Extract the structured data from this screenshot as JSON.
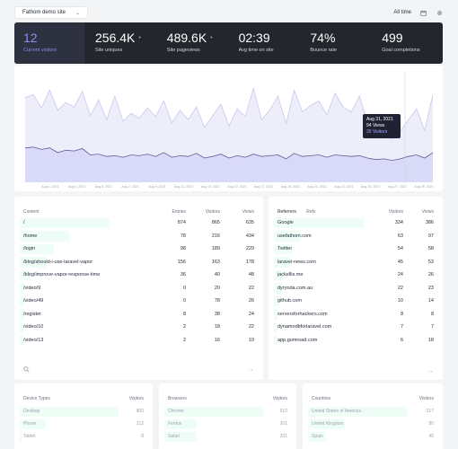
{
  "topbar": {
    "site": "Fathom demo site",
    "range": "All time",
    "calendar_icon": "calendar-icon",
    "settings_icon": "gear-icon"
  },
  "stats": [
    {
      "value": "12",
      "label": "Current visitors"
    },
    {
      "value": "256.4K",
      "label": "Site uniques",
      "dot": "•"
    },
    {
      "value": "489.6K",
      "label": "Site pageviews",
      "dot": "•"
    },
    {
      "value": "02:39",
      "label": "Avg time on site"
    },
    {
      "value": "74%",
      "label": "Bounce rate"
    },
    {
      "value": "499",
      "label": "Goal completions"
    }
  ],
  "chart_data": {
    "type": "area",
    "x": [
      "Aug 1 2021",
      "Aug 3 2021",
      "Aug 5 2021",
      "Aug 7 2021",
      "Aug 9 2021",
      "Aug 11 2021",
      "Aug 13 2021",
      "Aug 15 2021",
      "Aug 17 2021",
      "Aug 19 2021",
      "Aug 21 2021",
      "Aug 23 2021",
      "Aug 25 2021",
      "Aug 27 2021",
      "Aug 29 2021"
    ],
    "tick_labels": [
      "Aug 1, 2021",
      "Aug 3, 2021",
      "Aug 5, 2021",
      "Aug 7, 2021",
      "Aug 9, 2021",
      "Aug 11, 2021",
      "Aug 13, 2021",
      "Aug 15, 2021",
      "Aug 17, 2021",
      "Aug 19, 2021",
      "Aug 21, 2021",
      "Aug 23, 2021",
      "Aug 25, 2021",
      "Aug 27, 2021",
      "Aug 29, 2021"
    ],
    "series": [
      {
        "name": "Views",
        "values": [
          108,
          112,
          95,
          118,
          92,
          102,
          96,
          116,
          85,
          105,
          80,
          110,
          78,
          88,
          82,
          95,
          84,
          104,
          76,
          92,
          80,
          96,
          70,
          85,
          100,
          72,
          94,
          84,
          120,
          80,
          92,
          110,
          75,
          118,
          90,
          98,
          104,
          86,
          114,
          96,
          90,
          110,
          75,
          60,
          58,
          55,
          65,
          80,
          94,
          66,
          112
        ]
      },
      {
        "name": "Visitors",
        "values": [
          44,
          45,
          42,
          44,
          38,
          41,
          40,
          43,
          35,
          36,
          33,
          34,
          32,
          35,
          34,
          36,
          33,
          38,
          32,
          34,
          33,
          37,
          31,
          33,
          36,
          31,
          34,
          32,
          36,
          33,
          34,
          35,
          30,
          37,
          33,
          34,
          35,
          32,
          35,
          34,
          33,
          34,
          31,
          29,
          30,
          28,
          30,
          33,
          35,
          31,
          38
        ]
      }
    ],
    "ylim": [
      0,
      140
    ],
    "tooltip": {
      "date": "Aug 31, 2021",
      "views": "94 Views",
      "visitors": "35 Visitors"
    }
  },
  "content_table": {
    "headers": {
      "name": "Content",
      "entries": "Entries",
      "visitors": "Visitors",
      "views": "Views"
    },
    "rows": [
      {
        "name": "/",
        "entries": "874",
        "visitors": "865",
        "views": "635",
        "share": 1.0
      },
      {
        "name": "/home",
        "entries": "78",
        "visitors": "216",
        "views": "434",
        "share": 0.55
      },
      {
        "name": "/login",
        "entries": "98",
        "visitors": "189",
        "views": "229",
        "share": 0.38
      },
      {
        "name": "/blog/should-i-use-laravel-vapor",
        "entries": "156",
        "visitors": "163",
        "views": "178",
        "share": 0.3
      },
      {
        "name": "/blog/improve-vapor-response-time",
        "entries": "36",
        "visitors": "40",
        "views": "48",
        "share": 0.12
      },
      {
        "name": "/video/9",
        "entries": "0",
        "visitors": "20",
        "views": "22",
        "share": 0.05
      },
      {
        "name": "/video/49",
        "entries": "0",
        "visitors": "78",
        "views": "26",
        "share": 0.05
      },
      {
        "name": "/register",
        "entries": "8",
        "visitors": "38",
        "views": "24",
        "share": 0.05
      },
      {
        "name": "/video/10",
        "entries": "2",
        "visitors": "18",
        "views": "22",
        "share": 0.04
      },
      {
        "name": "/video/13",
        "entries": "2",
        "visitors": "16",
        "views": "19",
        "share": 0.04
      }
    ],
    "search_icon": "search-icon",
    "arrow_icon": "arrow-right-icon"
  },
  "referrers_table": {
    "tabs": [
      "Referrers",
      "Refs"
    ],
    "headers": {
      "visitors": "Visitors",
      "views": "Views"
    },
    "rows": [
      {
        "name": "Google",
        "visitors": "334",
        "views": "386",
        "share": 1.0
      },
      {
        "name": "usefathom.com",
        "visitors": "63",
        "views": "97",
        "share": 0.3
      },
      {
        "name": "Twitter",
        "visitors": "54",
        "views": "58",
        "share": 0.2
      },
      {
        "name": "laravel-news.com",
        "visitors": "45",
        "views": "53",
        "share": 0.18
      },
      {
        "name": "jackellis.me",
        "visitors": "24",
        "views": "26",
        "share": 0.1
      },
      {
        "name": "dyrynda.com.au",
        "visitors": "22",
        "views": "23",
        "share": 0.09
      },
      {
        "name": "github.com",
        "visitors": "10",
        "views": "14",
        "share": 0.05
      },
      {
        "name": "serversforhackers.com",
        "visitors": "8",
        "views": "8",
        "share": 0.04
      },
      {
        "name": "dynamodbforlaravel.com",
        "visitors": "7",
        "views": "7",
        "share": 0.03
      },
      {
        "name": "app.gumroad.com",
        "visitors": "6",
        "views": "18",
        "share": 0.03
      }
    ],
    "arrow_icon": "arrow-right-icon"
  },
  "devices": {
    "headers": {
      "name": "Device Types",
      "value": "Visitors"
    },
    "rows": [
      {
        "name": "Desktop",
        "value": "800",
        "share": 1.0
      },
      {
        "name": "Phone",
        "value": "212",
        "share": 0.26
      },
      {
        "name": "Tablet",
        "value": "8",
        "share": 0.02
      }
    ]
  },
  "browsers": {
    "headers": {
      "name": "Browsers",
      "value": "Visitors"
    },
    "rows": [
      {
        "name": "Chrome",
        "value": "610",
        "share": 1.0
      },
      {
        "name": "Firefox",
        "value": "201",
        "share": 0.33
      },
      {
        "name": "Safari",
        "value": "201",
        "share": 0.33
      }
    ]
  },
  "countries": {
    "headers": {
      "name": "Countries",
      "value": "Visitors"
    },
    "rows": [
      {
        "name": "United States of America",
        "value": "217",
        "share": 1.0
      },
      {
        "name": "United Kingdom",
        "value": "80",
        "share": 0.37
      },
      {
        "name": "Spain",
        "value": "40",
        "share": 0.18
      }
    ]
  }
}
